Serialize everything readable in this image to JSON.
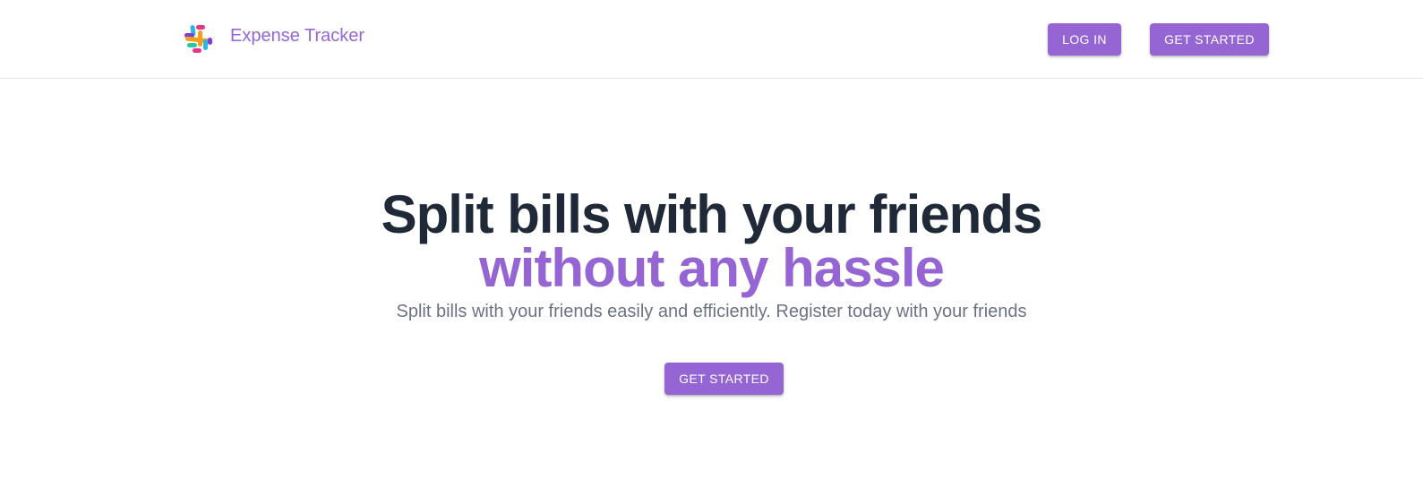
{
  "header": {
    "brand_name": "Expense Tracker",
    "login_label": "LOG IN",
    "get_started_label": "GET STARTED"
  },
  "hero": {
    "title_line1": "Split bills with your friends",
    "title_line2": "without any hassle",
    "subtitle": "Split bills with your friends easily and efficiently. Register today with your friends",
    "cta_label": "GET STARTED"
  },
  "colors": {
    "accent": "#9566d3",
    "heading": "#1f2937",
    "muted_text": "#6b7280"
  },
  "icons": {
    "logo": "multicolor-hash-logo-icon"
  }
}
